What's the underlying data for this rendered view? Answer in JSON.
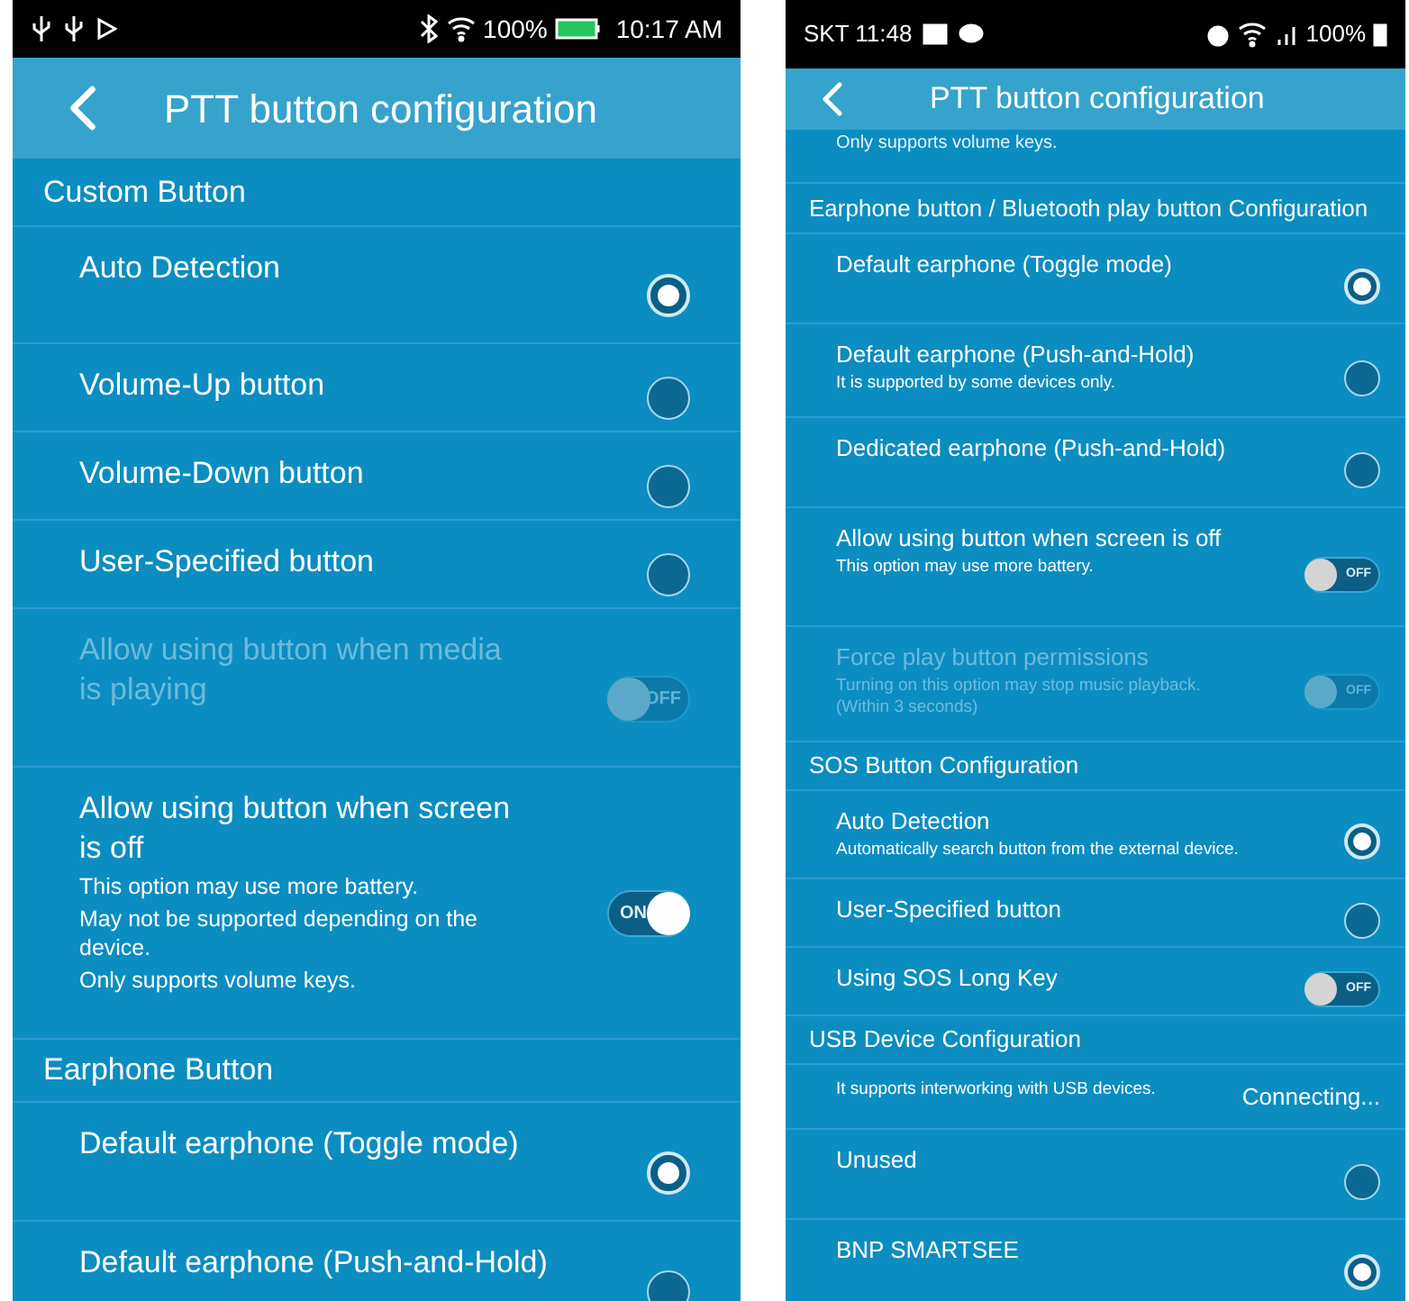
{
  "phones": [
    {
      "status_bar": {
        "time": "10:17 AM",
        "battery": "100%"
      },
      "header": {
        "title": "PTT button configuration"
      },
      "items": [
        {
          "kind": "section",
          "label": "Custom Button"
        },
        {
          "kind": "radio",
          "label": "Auto Detection",
          "selected": true
        },
        {
          "kind": "radio",
          "label": "Volume-Up button",
          "selected": false
        },
        {
          "kind": "radio",
          "label": "Volume-Down button",
          "selected": false
        },
        {
          "kind": "radio",
          "label": "User-Specified button",
          "selected": false
        },
        {
          "kind": "toggle",
          "label": "Allow using button when media is playing",
          "on": false,
          "state_label": "OFF",
          "disabled": true
        },
        {
          "kind": "toggle",
          "label": "Allow using button when screen is off",
          "on": true,
          "state_label": "ON",
          "disabled": false,
          "sub": [
            "This option may use more battery.",
            "May not be supported depending on the device.",
            "Only supports volume keys."
          ]
        },
        {
          "kind": "section",
          "label": "Earphone Button"
        },
        {
          "kind": "radio",
          "label": "Default earphone (Toggle mode)",
          "selected": true
        },
        {
          "kind": "radio",
          "label": "Default earphone (Push-and-Hold)",
          "selected": false
        }
      ]
    },
    {
      "status_bar": {
        "carrier_time": "SKT 11:48",
        "battery": "100%"
      },
      "header": {
        "title": "PTT button configuration"
      },
      "items": [
        {
          "kind": "caption",
          "label": "Only supports volume keys."
        },
        {
          "kind": "section",
          "label": "Earphone button / Bluetooth play button Configuration"
        },
        {
          "kind": "radio",
          "label": "Default earphone (Toggle mode)",
          "selected": true
        },
        {
          "kind": "radio",
          "label": "Default earphone (Push-and-Hold)",
          "selected": false,
          "sub": [
            "It is supported by some devices only."
          ]
        },
        {
          "kind": "radio",
          "label": "Dedicated earphone (Push-and-Hold)",
          "selected": false
        },
        {
          "kind": "toggle",
          "label": "Allow using button when screen is off",
          "on": false,
          "state_label": "OFF",
          "disabled": false,
          "sub": [
            "This option may use more battery."
          ]
        },
        {
          "kind": "toggle",
          "label": "Force play button permissions",
          "on": false,
          "state_label": "OFF",
          "disabled": true,
          "sub": [
            "Turning on this option may stop music playback.(Within 3 seconds)"
          ]
        },
        {
          "kind": "section",
          "label": "SOS Button Configuration"
        },
        {
          "kind": "radio",
          "label": "Auto Detection",
          "selected": true,
          "sub": [
            "Automatically search button from the external device."
          ]
        },
        {
          "kind": "radio",
          "label": "User-Specified button",
          "selected": false
        },
        {
          "kind": "toggle",
          "label": "Using SOS Long Key",
          "on": false,
          "state_label": "OFF",
          "disabled": false
        },
        {
          "kind": "section",
          "label": "USB Device Configuration"
        },
        {
          "kind": "note",
          "label": "It supports interworking with USB devices.",
          "value": "Connecting..."
        },
        {
          "kind": "radio",
          "label": "Unused",
          "selected": false
        },
        {
          "kind": "radio",
          "label": "BNP SMARTSEE",
          "selected": true
        }
      ]
    }
  ]
}
